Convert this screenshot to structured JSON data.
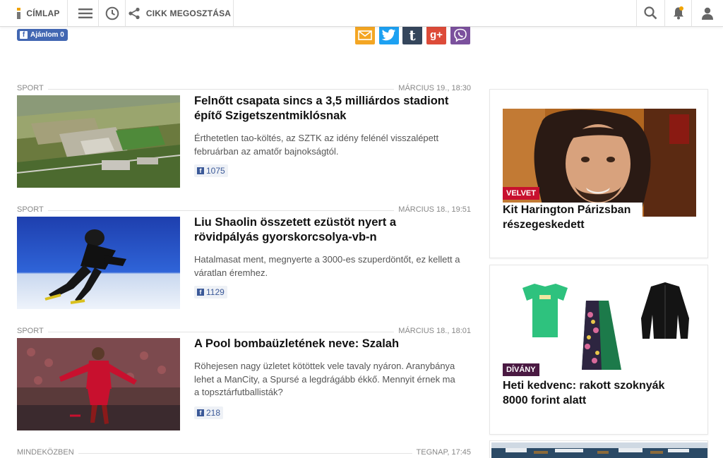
{
  "nav": {
    "home_label": "CÍMLAP",
    "share_label": "CIKK MEGOSZTÁSA",
    "icons": [
      "menu-icon",
      "clock-icon",
      "share-icon",
      "search-icon",
      "bell-icon",
      "user-icon"
    ]
  },
  "share_row": {
    "fb_like_label": "Ajánlom 0",
    "buttons": [
      {
        "name": "email",
        "color": "#f4a623"
      },
      {
        "name": "twitter",
        "color": "#1da1f2",
        "glyph": "t"
      },
      {
        "name": "tumblr",
        "color": "#35465c",
        "glyph": "t"
      },
      {
        "name": "google-plus",
        "color": "#dd4b39",
        "glyph": "g+"
      },
      {
        "name": "viber",
        "color": "#7b519d"
      }
    ]
  },
  "articles": [
    {
      "category": "SPORT",
      "date": "MÁRCIUS 19., 18:30",
      "title": "Felnőtt csapata sincs a 3,5 milliárdos stadiont építő Szigetszentmiklósnak",
      "lead": "Érthetetlen tao-költés, az SZTK az idény felénél visszalépett februárban az amatőr bajnokságtól.",
      "fb_count": "1075"
    },
    {
      "category": "SPORT",
      "date": "MÁRCIUS 18., 19:51",
      "title": "Liu Shaolin összetett ezüstöt nyert a rövidpályás gyorskorcsolya-vb-n",
      "lead": "Hatalmasat ment, megnyerte a 3000-es szuperdöntőt, ez kellett a váratlan éremhez.",
      "fb_count": "1129"
    },
    {
      "category": "SPORT",
      "date": "MÁRCIUS 18., 18:01",
      "title": "A Pool bombaüzletének neve: Szalah",
      "lead": "Röhejesen nagy üzletet kötöttek vele tavaly nyáron. Aranybánya lehet a ManCity, a Spursé a legdrágább ékkő. Mennyit érnek ma a topsztárfutballisták?",
      "fb_count": "218"
    },
    {
      "category": "MINDEKÖZBEN",
      "date": "TEGNAP, 17:45"
    }
  ],
  "sidebar": [
    {
      "tag": "VELVET",
      "tag_color": "#c8102e",
      "title": "Kit Harington Párizsban részegeskedett"
    },
    {
      "tag": "DÍVÁNY",
      "tag_color": "#4a1942",
      "title": "Heti kedvenc: rakott szoknyák 8000 forint alatt"
    }
  ]
}
